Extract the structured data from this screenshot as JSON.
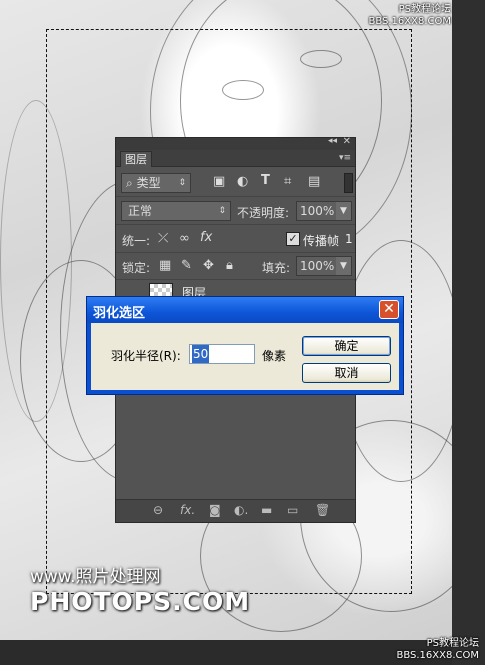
{
  "watermarks": {
    "top_right_1": "PS教程论坛",
    "top_right_2": "BBS.16XX8.COM",
    "bottom_right_1": "PS教程论坛",
    "bottom_right_2": "BBS.16XX8.COM",
    "site_line1": "www.照片处理网",
    "site_line2": "PHOTOPS.COM"
  },
  "layers_panel": {
    "tab": "图层",
    "filter_label": "类型",
    "blend_mode": "正常",
    "opacity_label": "不透明度:",
    "opacity_value": "100%",
    "unify_label": "统一:",
    "propagate_label": "传播帧",
    "propagate_value": "1",
    "lock_label": "锁定:",
    "fill_label": "填充:",
    "fill_value": "100%",
    "layer_name": "图层"
  },
  "feather_dialog": {
    "title": "羽化选区",
    "radius_label": "羽化半径(R):",
    "radius_value": "50",
    "unit": "像素",
    "ok_label": "确定",
    "cancel_label": "取消"
  }
}
